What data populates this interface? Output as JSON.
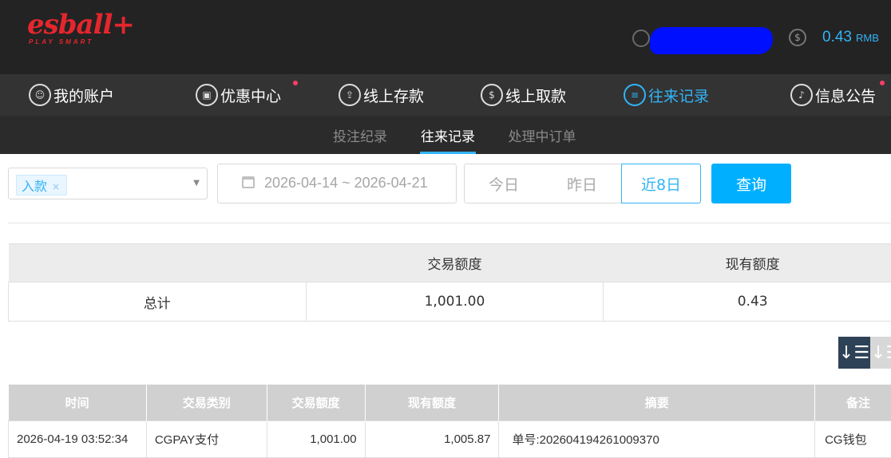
{
  "header": {
    "logo_text": "esball+",
    "logo_tagline": "PLAY SMART",
    "balance_icon": "$",
    "balance_amount": "0.43",
    "balance_currency": "RMB"
  },
  "main_nav": [
    {
      "label": "我的账户",
      "icon": "user-icon",
      "glyph": "☺",
      "active": false
    },
    {
      "label": "优惠中心",
      "icon": "gift-icon",
      "glyph": "▣",
      "active": false
    },
    {
      "label": "线上存款",
      "icon": "deposit-icon",
      "glyph": "⇪",
      "active": false
    },
    {
      "label": "线上取款",
      "icon": "withdraw-icon",
      "glyph": "$",
      "active": false
    },
    {
      "label": "往来记录",
      "icon": "records-icon",
      "glyph": "≡",
      "active": true
    },
    {
      "label": "信息公告",
      "icon": "bell-icon",
      "glyph": "♪",
      "active": false
    }
  ],
  "sub_nav": [
    {
      "label": "投注纪录",
      "active": false
    },
    {
      "label": "往来记录",
      "active": true
    },
    {
      "label": "处理中订单",
      "active": false
    }
  ],
  "filter": {
    "type_tag": "入款",
    "tag_remove": "×",
    "date_range": "2026-04-14 ~ 2026-04-21",
    "quick_ranges": [
      {
        "label": "今日",
        "active": false
      },
      {
        "label": "昨日",
        "active": false
      },
      {
        "label": "近8日",
        "active": true
      }
    ],
    "query_label": "查询"
  },
  "summary": {
    "headers": [
      "",
      "交易额度",
      "现有额度"
    ],
    "row": [
      "总计",
      "1,001.00",
      "0.43"
    ]
  },
  "sort": {
    "desc_glyph": "↓☰",
    "asc_glyph": "↓☰"
  },
  "records": {
    "headers": [
      "时间",
      "交易类别",
      "交易额度",
      "现有额度",
      "摘要",
      "备注"
    ],
    "rows": [
      [
        "2026-04-19 03:52:34",
        "CGPAY支付",
        "1,001.00",
        "1,005.87",
        "单号:202604194261009370",
        "CG钱包"
      ]
    ]
  },
  "colors": {
    "accent": "#31b4f6",
    "button": "#00b0ff",
    "brand_red": "#e5262d",
    "header_bg": "#232323",
    "nav_bg": "#333333",
    "notify_dot": "#ff3d6a"
  }
}
